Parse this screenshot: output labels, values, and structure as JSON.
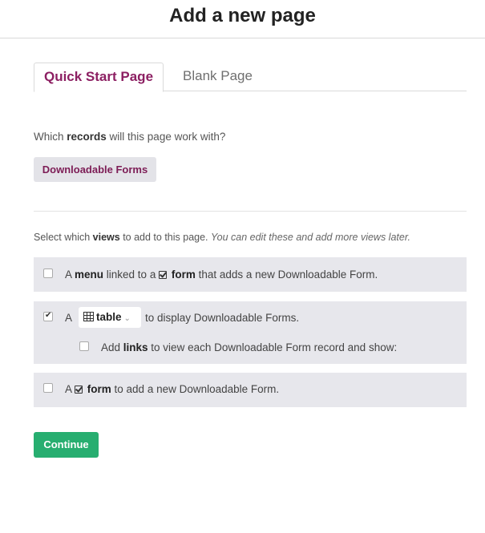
{
  "header": {
    "title": "Add a new page"
  },
  "tabs": [
    {
      "label": "Quick Start Page",
      "active": true
    },
    {
      "label": "Blank Page",
      "active": false
    }
  ],
  "records": {
    "question_pre": "Which ",
    "question_bold": "records",
    "question_post": " will this page work with?",
    "button_label": "Downloadable Forms"
  },
  "views": {
    "intro_pre": "Select which ",
    "intro_bold": "views",
    "intro_post": " to add to this page. ",
    "intro_italic": "You can edit these and add more views later.",
    "options": [
      {
        "checked": false,
        "pre": "A ",
        "bold1": "menu",
        "mid": " linked to a ",
        "bold2": "form",
        "post": " that adds a new Downloadable Form."
      },
      {
        "checked": true,
        "pre": "A",
        "select_label": "table",
        "post": "to display Downloadable Forms.",
        "sub": {
          "checked": false,
          "pre": "Add ",
          "bold": "links",
          "post": " to view each Downloadable Form record and show:"
        }
      },
      {
        "checked": false,
        "pre": "A ",
        "bold": "form",
        "post": " to add a new Downloadable Form."
      }
    ]
  },
  "continue_label": "Continue",
  "colors": {
    "accent": "#8c1f62",
    "continue": "#27ae70",
    "option_bg": "#e7e7ec"
  }
}
